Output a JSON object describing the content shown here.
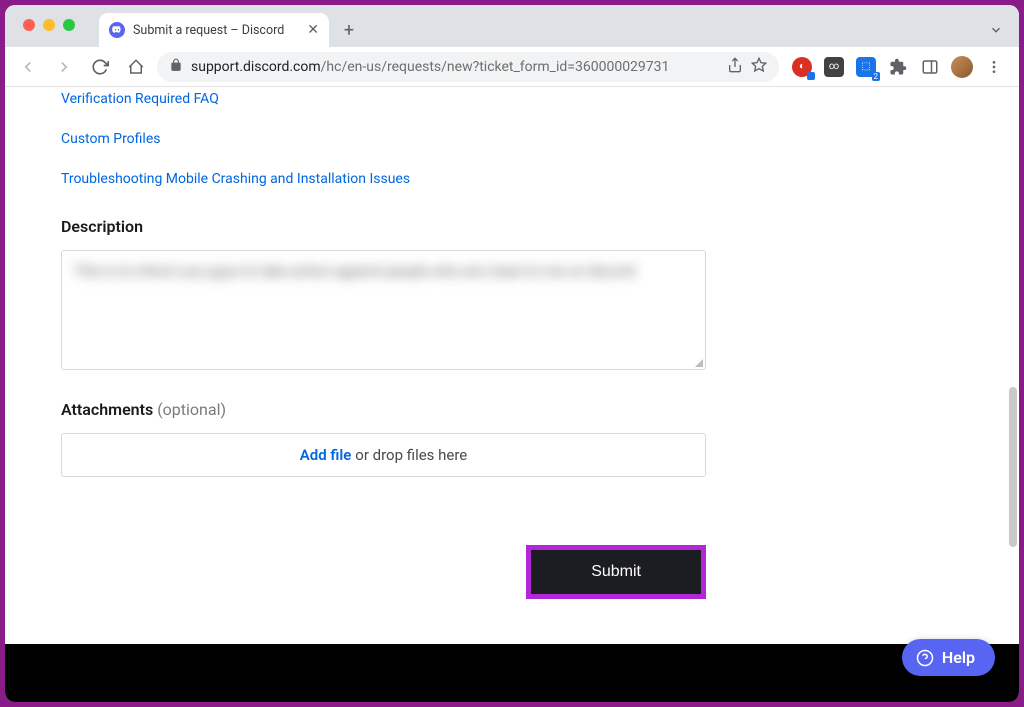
{
  "browser": {
    "tab_title": "Submit a request – Discord",
    "url_domain": "support.discord.com",
    "url_path": "/hc/en-us/requests/new?ticket_form_id=360000029731"
  },
  "links": [
    "Verification Required FAQ",
    "Custom Profiles",
    "Troubleshooting Mobile Crashing and Installation Issues"
  ],
  "form": {
    "description_label": "Description",
    "description_value": "This is to inform you guys to take action against people who are mean to me on discord",
    "attachments_label": "Attachments",
    "attachments_optional": "(optional)",
    "addfile_label": "Add file",
    "dropfiles_label": "or drop files here",
    "submit_label": "Submit"
  },
  "help_widget": {
    "label": "Help"
  },
  "icons": {
    "extension_badge_count": "2"
  }
}
